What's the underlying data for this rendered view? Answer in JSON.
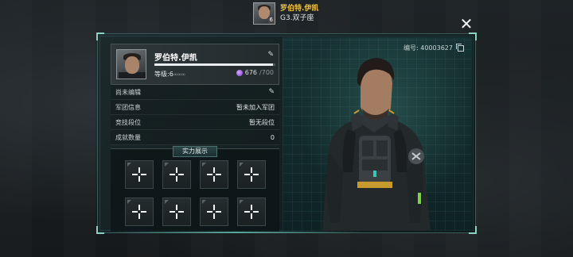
{
  "top": {
    "avatar_level": "6",
    "name": "罗伯特.伊凯",
    "subtitle": "G3.双子座"
  },
  "close_icon": "close-icon",
  "profile": {
    "name": "罗伯特.伊凯",
    "level_label": "等级:6",
    "level_dots": "∞∞∞",
    "exp_progress_percent": 98,
    "energy_current": "676",
    "energy_max": "/700",
    "id_label": "编号: 40003627"
  },
  "info_rows": [
    {
      "label": "尚未编辑",
      "value": ""
    },
    {
      "label": "军团信息",
      "value": "暂未加入军团"
    },
    {
      "label": "竞技段位",
      "value": "暂无段位"
    },
    {
      "label": "成就数量",
      "value": "0"
    }
  ],
  "showcase": {
    "title": "实力展示",
    "slot_count": 8
  },
  "colors": {
    "accent": "#8fd0c4",
    "name_gold": "#f0c040",
    "energy": "#9b59d6"
  }
}
